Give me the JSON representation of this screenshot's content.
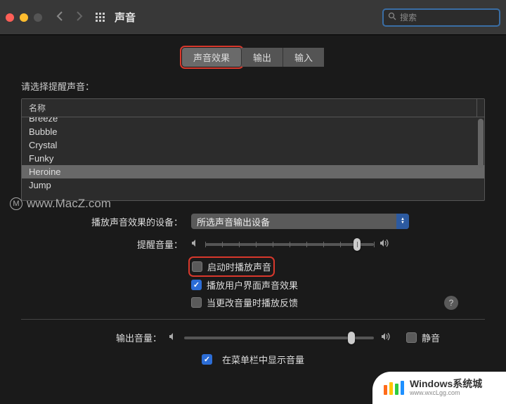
{
  "titlebar": {
    "title": "声音",
    "search_placeholder": "搜索"
  },
  "tabs": [
    {
      "label": "声音效果",
      "active": true,
      "highlighted": true
    },
    {
      "label": "输出",
      "active": false,
      "highlighted": false
    },
    {
      "label": "输入",
      "active": false,
      "highlighted": false
    }
  ],
  "section": {
    "prompt": "请选择提醒声音：",
    "header": "名称",
    "items": [
      {
        "label": "Breeze",
        "selected": false,
        "cutoff": true
      },
      {
        "label": "Bubble",
        "selected": false
      },
      {
        "label": "Crystal",
        "selected": false
      },
      {
        "label": "Funky",
        "selected": false
      },
      {
        "label": "Heroine",
        "selected": true
      },
      {
        "label": "Jump",
        "selected": false
      }
    ]
  },
  "device_row": {
    "label": "播放声音效果的设备：",
    "value": "所选声音输出设备"
  },
  "alert_volume": {
    "label": "提醒音量：",
    "value_pct": 90
  },
  "checkboxes": {
    "startup": {
      "label": "启动时播放声音",
      "checked": false,
      "highlighted": true
    },
    "ui_effects": {
      "label": "播放用户界面声音效果",
      "checked": true
    },
    "feedback": {
      "label": "当更改音量时播放反馈",
      "checked": false
    }
  },
  "output_volume": {
    "label": "输出音量：",
    "value_pct": 88,
    "mute_label": "静音",
    "mute_checked": false
  },
  "menubar": {
    "label": "在菜单栏中显示音量",
    "checked": true
  },
  "help_label": "?",
  "watermark": {
    "ring": "M",
    "text": "www.MacZ.com"
  },
  "badge": {
    "title": "Windows系统城",
    "sub": "www.wxcLgg.com",
    "bars": [
      {
        "c": "#ff6b1a",
        "h": 14
      },
      {
        "c": "#ffc400",
        "h": 18
      },
      {
        "c": "#2ecc40",
        "h": 16
      },
      {
        "c": "#1e90ff",
        "h": 20
      }
    ]
  }
}
